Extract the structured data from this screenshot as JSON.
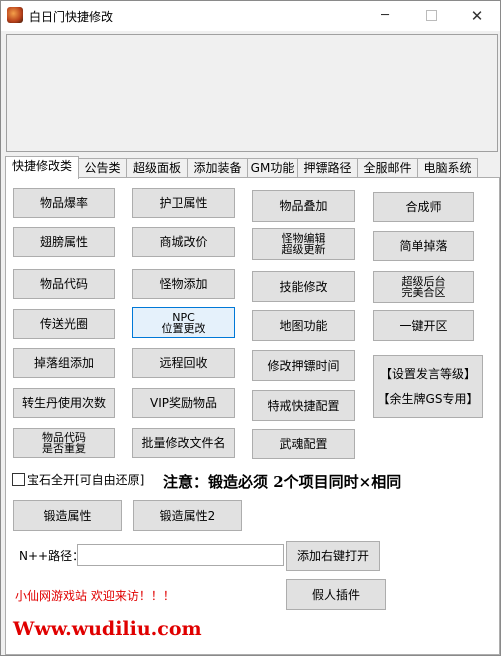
{
  "window": {
    "title": "白日门快捷修改",
    "minimize": "─",
    "close": "✕"
  },
  "tabs": [
    "快捷修改类",
    "公告类",
    "超级面板",
    "添加装备",
    "GM功能",
    "押镖路径",
    "全服邮件",
    "电脑系统"
  ],
  "buttons": {
    "b1": "物品爆率",
    "b2": "护卫属性",
    "b3": "物品叠加",
    "b4": "合成师",
    "b5": "翅膀属性",
    "b6": "商城改价",
    "b7a": "怪物编辑",
    "b7b": "超级更新",
    "b8": "简单掉落",
    "b9": "物品代码",
    "b10": "怪物添加",
    "b11": "技能修改",
    "b12a": "超级后台",
    "b12b": "完美合区",
    "b13": "传送光圈",
    "b14a": "NPC",
    "b14b": "位置更改",
    "b15": "地图功能",
    "b16": "一键开区",
    "b17": "掉落组添加",
    "b18": "远程回收",
    "b19": "修改押镖时间",
    "b20a": "【设置发言等级】",
    "b20b": "【余生牌GS专用】",
    "b21": "转生丹使用次数",
    "b22": "VIP奖励物品",
    "b23": "特戒快捷配置",
    "b24a": "物品代码",
    "b24b": "是否重复",
    "b25": "批量修改文件名",
    "b26": "武魂配置",
    "forge1": "锻造属性",
    "forge2": "锻造属性2",
    "add_menu": "添加右键打开",
    "fake_plugin": "假人插件"
  },
  "gem_checkbox": "宝石全开[可自由还原]",
  "notice": "注意：锻造必须 2个项目同时×相同",
  "path": {
    "label": "N++路径：",
    "value": ""
  },
  "welcome": "小仙网游戏站 欢迎来访！！！",
  "site": "Www.wudiliu.com",
  "colors": {
    "accent_red": "#e00000",
    "focus_blue": "#0078d7"
  }
}
